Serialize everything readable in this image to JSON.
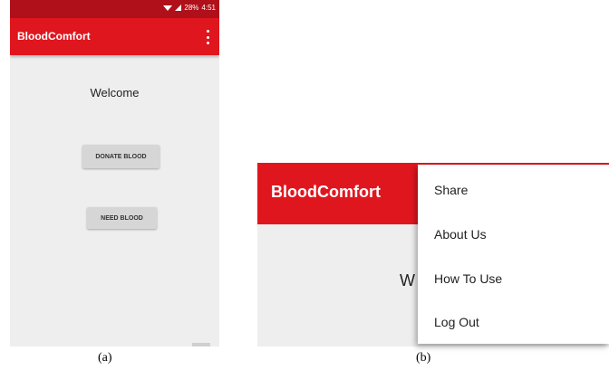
{
  "panel_a": {
    "status": {
      "battery": "28%",
      "time": "4:51"
    },
    "app_title": "BloodComfort",
    "welcome": "Welcome",
    "donate_button": "DONATE BLOOD",
    "need_button": "NEED BLOOD",
    "caption": "(a)"
  },
  "panel_b": {
    "app_title": "BloodComfort",
    "welcome_partial": "W",
    "menu": {
      "items": [
        "Share",
        "About Us",
        "How To Use",
        "Log Out"
      ]
    },
    "caption": "(b)"
  },
  "colors": {
    "primary": "#e0161f",
    "status_bar": "#b01019",
    "background": "#eeeeee"
  },
  "icons": [
    "wifi-icon",
    "signal-icon",
    "overflow-menu-icon"
  ]
}
